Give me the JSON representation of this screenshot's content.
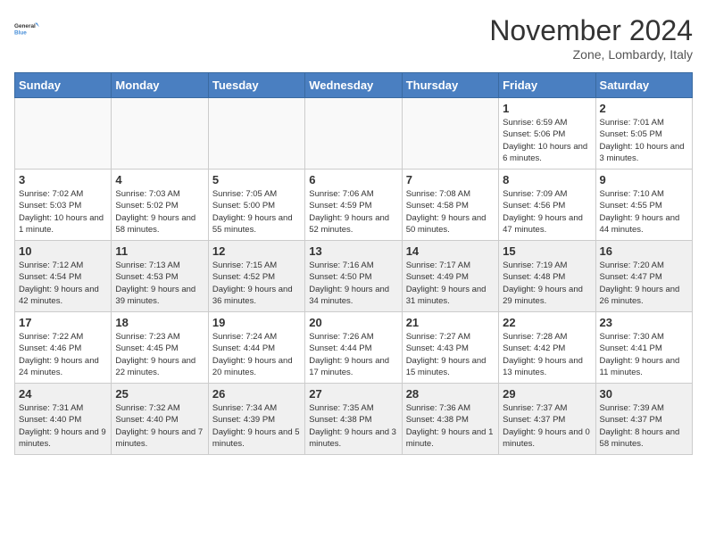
{
  "header": {
    "logo_line1": "General",
    "logo_line2": "Blue",
    "month_title": "November 2024",
    "subtitle": "Zone, Lombardy, Italy"
  },
  "days_of_week": [
    "Sunday",
    "Monday",
    "Tuesday",
    "Wednesday",
    "Thursday",
    "Friday",
    "Saturday"
  ],
  "weeks": [
    [
      {
        "day": "",
        "info": ""
      },
      {
        "day": "",
        "info": ""
      },
      {
        "day": "",
        "info": ""
      },
      {
        "day": "",
        "info": ""
      },
      {
        "day": "",
        "info": ""
      },
      {
        "day": "1",
        "info": "Sunrise: 6:59 AM\nSunset: 5:06 PM\nDaylight: 10 hours and 6 minutes."
      },
      {
        "day": "2",
        "info": "Sunrise: 7:01 AM\nSunset: 5:05 PM\nDaylight: 10 hours and 3 minutes."
      }
    ],
    [
      {
        "day": "3",
        "info": "Sunrise: 7:02 AM\nSunset: 5:03 PM\nDaylight: 10 hours and 1 minute."
      },
      {
        "day": "4",
        "info": "Sunrise: 7:03 AM\nSunset: 5:02 PM\nDaylight: 9 hours and 58 minutes."
      },
      {
        "day": "5",
        "info": "Sunrise: 7:05 AM\nSunset: 5:00 PM\nDaylight: 9 hours and 55 minutes."
      },
      {
        "day": "6",
        "info": "Sunrise: 7:06 AM\nSunset: 4:59 PM\nDaylight: 9 hours and 52 minutes."
      },
      {
        "day": "7",
        "info": "Sunrise: 7:08 AM\nSunset: 4:58 PM\nDaylight: 9 hours and 50 minutes."
      },
      {
        "day": "8",
        "info": "Sunrise: 7:09 AM\nSunset: 4:56 PM\nDaylight: 9 hours and 47 minutes."
      },
      {
        "day": "9",
        "info": "Sunrise: 7:10 AM\nSunset: 4:55 PM\nDaylight: 9 hours and 44 minutes."
      }
    ],
    [
      {
        "day": "10",
        "info": "Sunrise: 7:12 AM\nSunset: 4:54 PM\nDaylight: 9 hours and 42 minutes."
      },
      {
        "day": "11",
        "info": "Sunrise: 7:13 AM\nSunset: 4:53 PM\nDaylight: 9 hours and 39 minutes."
      },
      {
        "day": "12",
        "info": "Sunrise: 7:15 AM\nSunset: 4:52 PM\nDaylight: 9 hours and 36 minutes."
      },
      {
        "day": "13",
        "info": "Sunrise: 7:16 AM\nSunset: 4:50 PM\nDaylight: 9 hours and 34 minutes."
      },
      {
        "day": "14",
        "info": "Sunrise: 7:17 AM\nSunset: 4:49 PM\nDaylight: 9 hours and 31 minutes."
      },
      {
        "day": "15",
        "info": "Sunrise: 7:19 AM\nSunset: 4:48 PM\nDaylight: 9 hours and 29 minutes."
      },
      {
        "day": "16",
        "info": "Sunrise: 7:20 AM\nSunset: 4:47 PM\nDaylight: 9 hours and 26 minutes."
      }
    ],
    [
      {
        "day": "17",
        "info": "Sunrise: 7:22 AM\nSunset: 4:46 PM\nDaylight: 9 hours and 24 minutes."
      },
      {
        "day": "18",
        "info": "Sunrise: 7:23 AM\nSunset: 4:45 PM\nDaylight: 9 hours and 22 minutes."
      },
      {
        "day": "19",
        "info": "Sunrise: 7:24 AM\nSunset: 4:44 PM\nDaylight: 9 hours and 20 minutes."
      },
      {
        "day": "20",
        "info": "Sunrise: 7:26 AM\nSunset: 4:44 PM\nDaylight: 9 hours and 17 minutes."
      },
      {
        "day": "21",
        "info": "Sunrise: 7:27 AM\nSunset: 4:43 PM\nDaylight: 9 hours and 15 minutes."
      },
      {
        "day": "22",
        "info": "Sunrise: 7:28 AM\nSunset: 4:42 PM\nDaylight: 9 hours and 13 minutes."
      },
      {
        "day": "23",
        "info": "Sunrise: 7:30 AM\nSunset: 4:41 PM\nDaylight: 9 hours and 11 minutes."
      }
    ],
    [
      {
        "day": "24",
        "info": "Sunrise: 7:31 AM\nSunset: 4:40 PM\nDaylight: 9 hours and 9 minutes."
      },
      {
        "day": "25",
        "info": "Sunrise: 7:32 AM\nSunset: 4:40 PM\nDaylight: 9 hours and 7 minutes."
      },
      {
        "day": "26",
        "info": "Sunrise: 7:34 AM\nSunset: 4:39 PM\nDaylight: 9 hours and 5 minutes."
      },
      {
        "day": "27",
        "info": "Sunrise: 7:35 AM\nSunset: 4:38 PM\nDaylight: 9 hours and 3 minutes."
      },
      {
        "day": "28",
        "info": "Sunrise: 7:36 AM\nSunset: 4:38 PM\nDaylight: 9 hours and 1 minute."
      },
      {
        "day": "29",
        "info": "Sunrise: 7:37 AM\nSunset: 4:37 PM\nDaylight: 9 hours and 0 minutes."
      },
      {
        "day": "30",
        "info": "Sunrise: 7:39 AM\nSunset: 4:37 PM\nDaylight: 8 hours and 58 minutes."
      }
    ]
  ]
}
